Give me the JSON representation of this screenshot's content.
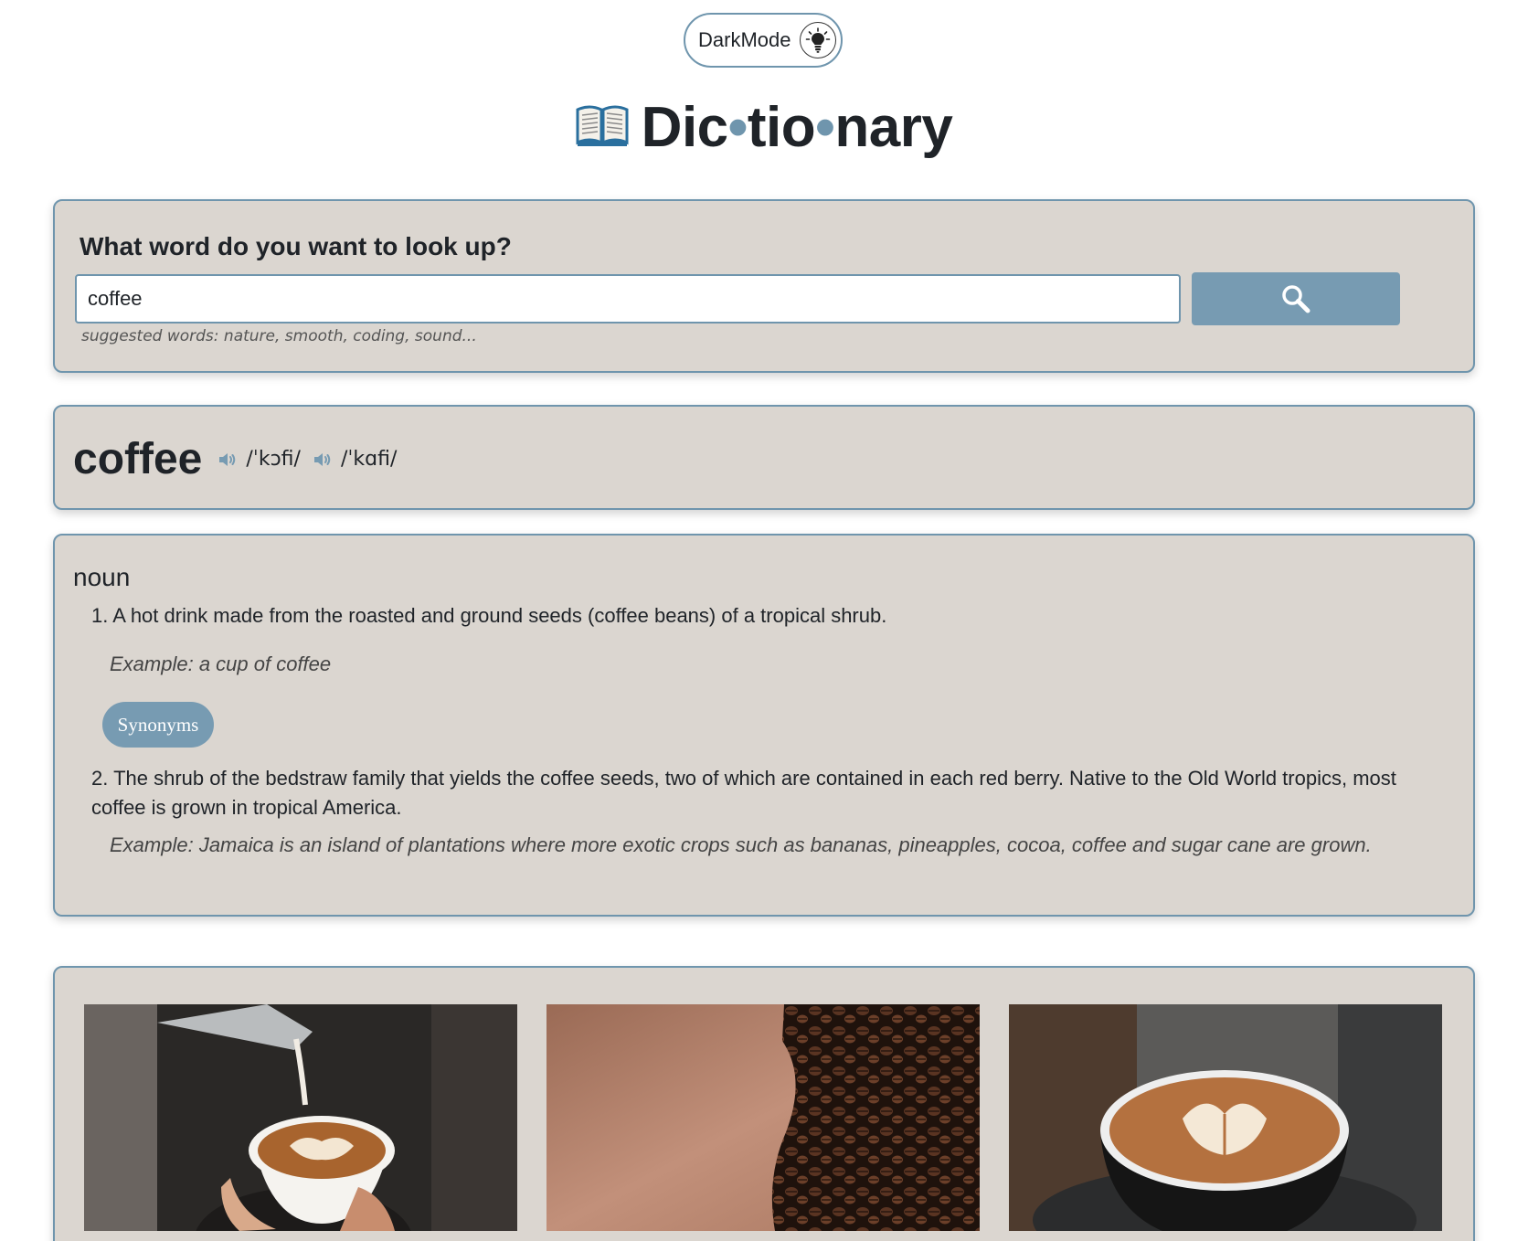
{
  "header": {
    "darkmode_label": "DarkMode",
    "title_parts": [
      "Dic",
      "tio",
      "nary"
    ],
    "title_separator": "•"
  },
  "search": {
    "question": "What word do you want to look up?",
    "value": "coffee",
    "suggestions": "suggested words: nature, smooth, coding, sound..."
  },
  "word": {
    "text": "coffee",
    "phonetics": [
      "/ˈkɔfi/",
      "/ˈkɑfi/"
    ]
  },
  "meaning": {
    "part_of_speech": "noun",
    "definitions": [
      {
        "text": "1. A hot drink made from the roasted and ground seeds (coffee beans) of a tropical shrub.",
        "example": "Example: a cup of coffee",
        "synonyms_label": "Synonyms"
      },
      {
        "text": "2. The shrub of the bedstraw family that yields the coffee seeds, two of which are contained in each red berry. Native to the Old World tropics, most coffee is grown in tropical America.",
        "example": "Example: Jamaica is an island of plantations where more exotic crops such as bananas, pineapples, cocoa, coffee and sugar cane are grown."
      }
    ]
  },
  "images": [
    "latte-art-pour-image",
    "coffee-beans-image",
    "latte-cup-image"
  ],
  "colors": {
    "accent": "#779bb2",
    "card_bg": "#dbd6d0",
    "card_border": "#6f95ad"
  }
}
